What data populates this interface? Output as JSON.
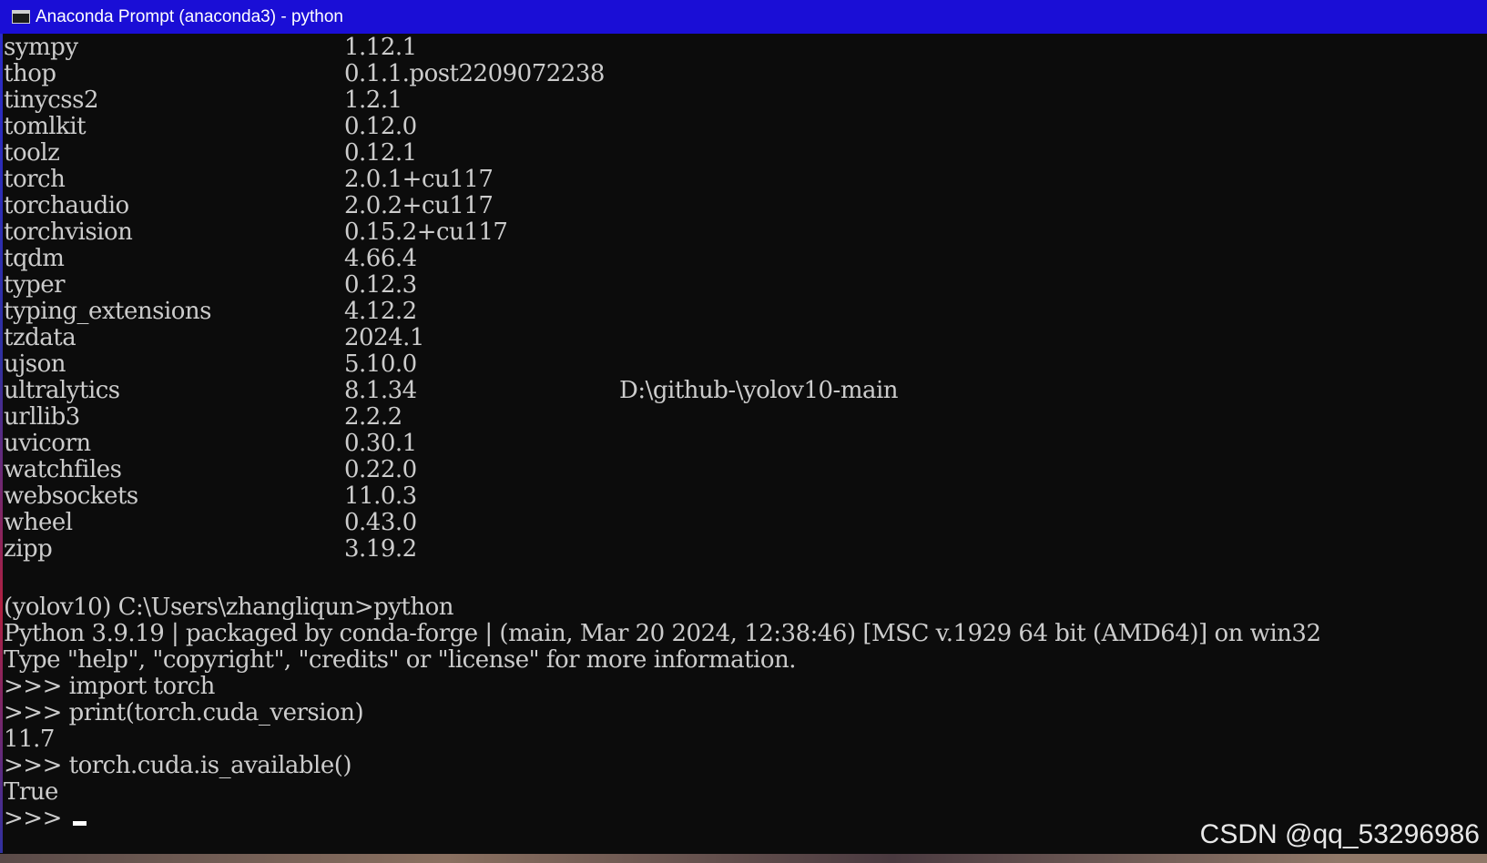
{
  "window": {
    "title": "Anaconda Prompt (anaconda3) - python"
  },
  "packages": [
    {
      "name": "sympy",
      "version": "1.12.1",
      "location": ""
    },
    {
      "name": "thop",
      "version": "0.1.1.post2209072238",
      "location": ""
    },
    {
      "name": "tinycss2",
      "version": "1.2.1",
      "location": ""
    },
    {
      "name": "tomlkit",
      "version": "0.12.0",
      "location": ""
    },
    {
      "name": "toolz",
      "version": "0.12.1",
      "location": ""
    },
    {
      "name": "torch",
      "version": "2.0.1+cu117",
      "location": ""
    },
    {
      "name": "torchaudio",
      "version": "2.0.2+cu117",
      "location": ""
    },
    {
      "name": "torchvision",
      "version": "0.15.2+cu117",
      "location": ""
    },
    {
      "name": "tqdm",
      "version": "4.66.4",
      "location": ""
    },
    {
      "name": "typer",
      "version": "0.12.3",
      "location": ""
    },
    {
      "name": "typing_extensions",
      "version": "4.12.2",
      "location": ""
    },
    {
      "name": "tzdata",
      "version": "2024.1",
      "location": ""
    },
    {
      "name": "ujson",
      "version": "5.10.0",
      "location": ""
    },
    {
      "name": "ultralytics",
      "version": "8.1.34",
      "location": "D:\\github-\\yolov10-main"
    },
    {
      "name": "urllib3",
      "version": "2.2.2",
      "location": ""
    },
    {
      "name": "uvicorn",
      "version": "0.30.1",
      "location": ""
    },
    {
      "name": "watchfiles",
      "version": "0.22.0",
      "location": ""
    },
    {
      "name": "websockets",
      "version": "11.0.3",
      "location": ""
    },
    {
      "name": "wheel",
      "version": "0.43.0",
      "location": ""
    },
    {
      "name": "zipp",
      "version": "3.19.2",
      "location": ""
    }
  ],
  "session": {
    "prompt_command": "(yolov10) C:\\Users\\zhangliqun>python",
    "python_banner": "Python 3.9.19 | packaged by conda-forge | (main, Mar 20 2024, 12:38:46) [MSC v.1929 64 bit (AMD64)] on win32",
    "help_hint": "Type \"help\", \"copyright\", \"credits\" or \"license\" for more information.",
    "cmd_import": ">>> import torch",
    "cmd_print": ">>> print(torch.cuda_version)",
    "out_print": "11.7",
    "cmd_available": ">>> torch.cuda.is_available()",
    "out_available": "True",
    "current_prompt": ">>> "
  },
  "watermark": "CSDN @qq_53296986"
}
